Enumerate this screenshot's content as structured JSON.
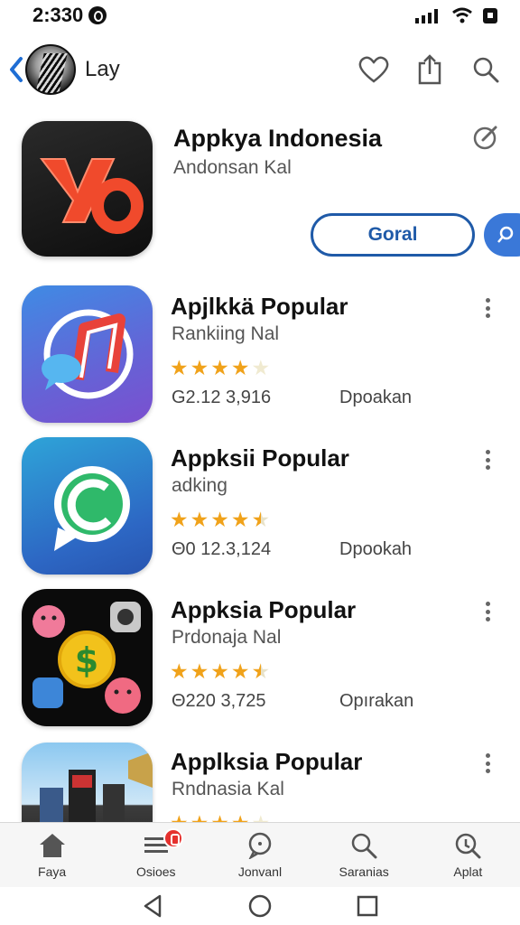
{
  "status_bar": {
    "time": "2:330"
  },
  "top_bar": {
    "title": "Lay"
  },
  "featured": {
    "title": "Appkya Indonesia",
    "subtitle": "Andonsan Kal",
    "get_label": "Goral"
  },
  "apps": [
    {
      "title": "Apjlkkä Popular",
      "subtitle": "Rankiing Nal",
      "rating": 4,
      "count": "G2.12 3,916",
      "action": "Dpoakan"
    },
    {
      "title": "Appksii Popular",
      "subtitle": "adking",
      "rating": 4.5,
      "count": "Θ0 12.3,124",
      "action": "Dpookah"
    },
    {
      "title": "Appksia Popular",
      "subtitle": "Prdonaja Nal",
      "rating": 4.5,
      "count": "Θ220 3,725",
      "action": "Opırakan"
    },
    {
      "title": "Applksia Popular",
      "subtitle": "Rndnasia Kal",
      "rating": 4
    }
  ],
  "bottom_nav": {
    "items": [
      {
        "label": "Faya",
        "icon": "home-icon"
      },
      {
        "label": "Osioes",
        "icon": "list-icon"
      },
      {
        "label": "Jonvanl",
        "icon": "chat-icon"
      },
      {
        "label": "Saranias",
        "icon": "search-icon"
      },
      {
        "label": "Aplat",
        "icon": "zoom-icon"
      }
    ]
  },
  "colors": {
    "accent": "#1f5aa8",
    "star": "#f0a21a",
    "badge": "#e5312e"
  }
}
